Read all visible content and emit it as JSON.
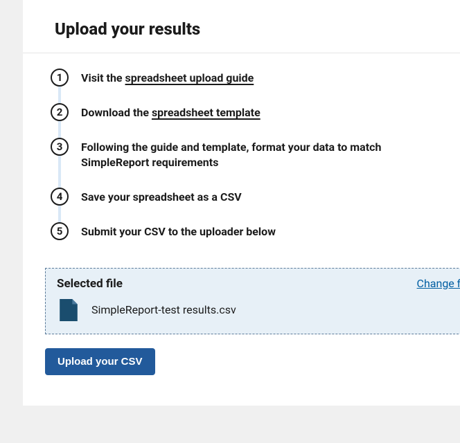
{
  "title": "Upload your results",
  "steps": [
    {
      "prefix": "Visit the ",
      "link": "spreadsheet upload guide",
      "suffix": ""
    },
    {
      "prefix": "Download the ",
      "link": "spreadsheet template",
      "suffix": ""
    },
    {
      "prefix": "Following the guide and template, format your data to match SimpleReport requirements",
      "link": "",
      "suffix": ""
    },
    {
      "prefix": "Save your spreadsheet as a CSV",
      "link": "",
      "suffix": ""
    },
    {
      "prefix": "Submit your CSV to the uploader below",
      "link": "",
      "suffix": ""
    }
  ],
  "selectedFile": {
    "label": "Selected file",
    "changeLink": "Change file",
    "fileName": "SimpleReport-test results.csv"
  },
  "uploadButton": "Upload your CSV"
}
